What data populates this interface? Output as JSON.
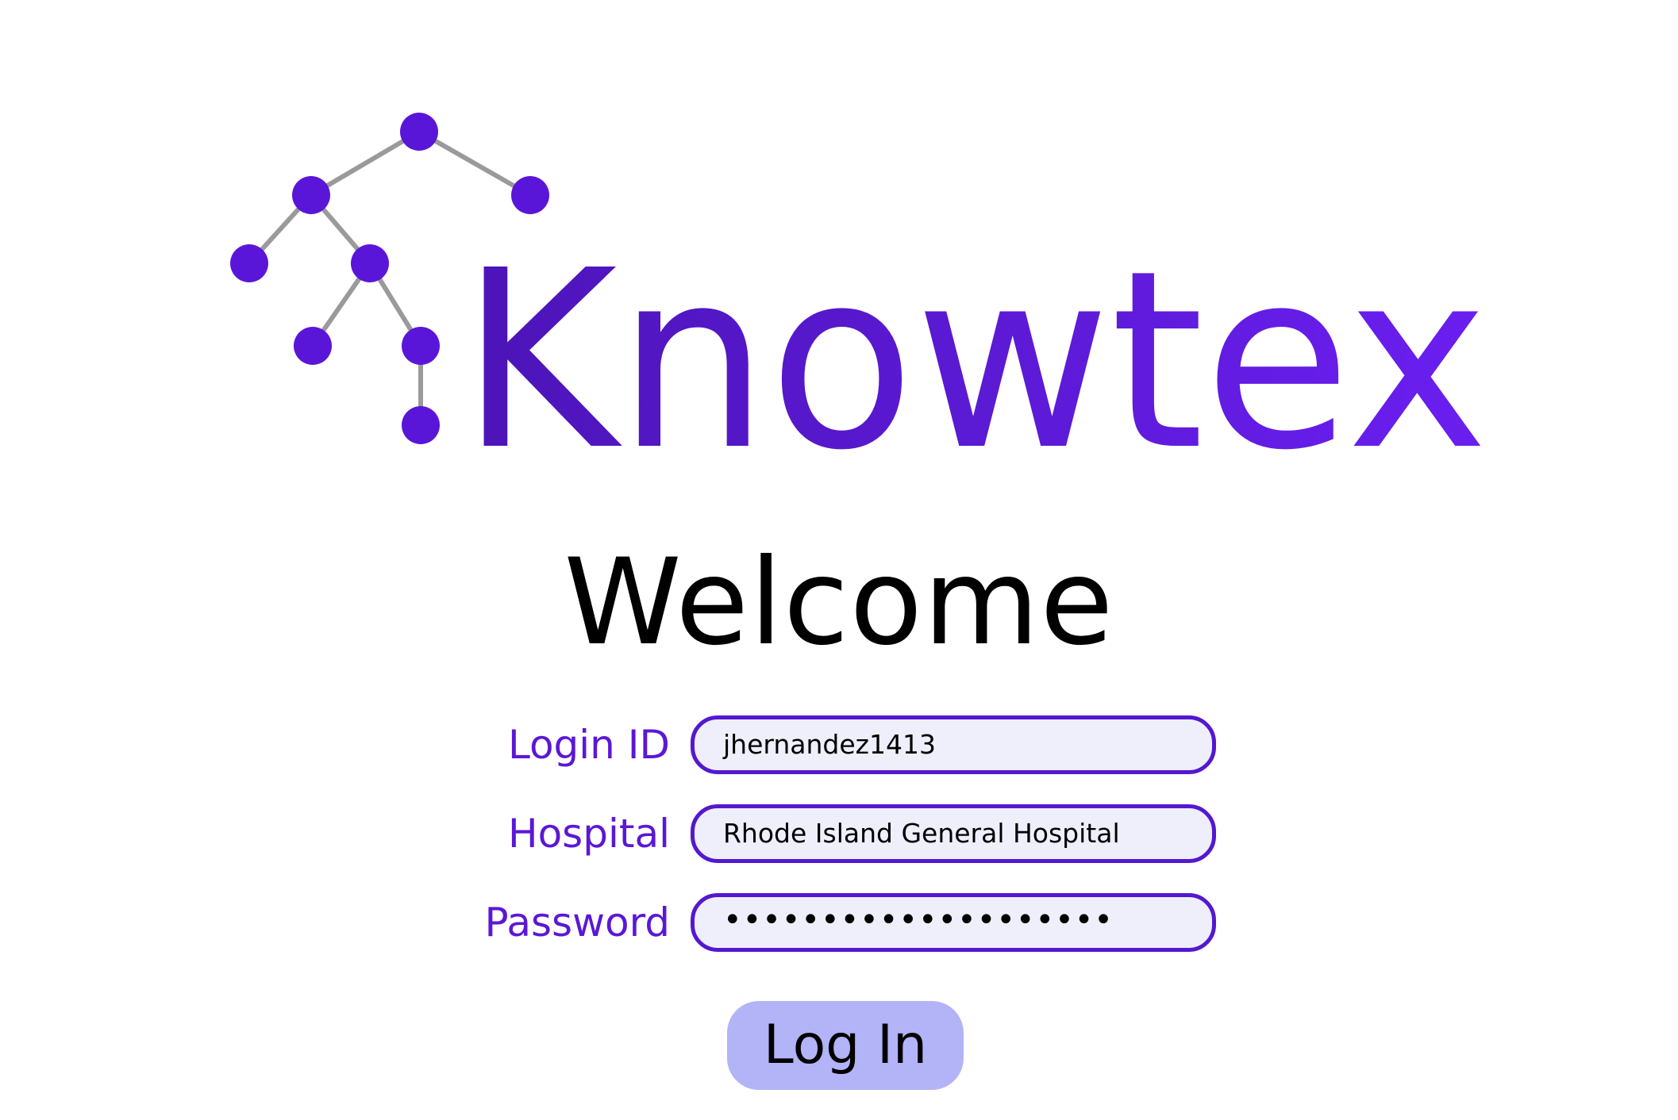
{
  "brand": {
    "name": "Knowtex",
    "primary_color": "#5418d0",
    "node_color": "#5a16d8",
    "edge_color": "#9a9a9a",
    "logo_icon": "knowledge-tree-icon"
  },
  "heading": {
    "title": "Welcome"
  },
  "form": {
    "login_id": {
      "label": "Login ID",
      "value": "jhernandez1413"
    },
    "hospital": {
      "label": "Hospital",
      "value": "Rhode Island General Hospital"
    },
    "password": {
      "label": "Password",
      "value": "••••••••••••••••••••"
    },
    "field_bg_color": "#eeeffb"
  },
  "actions": {
    "login_label": "Log In",
    "login_bg_color": "#b3b3f7"
  }
}
